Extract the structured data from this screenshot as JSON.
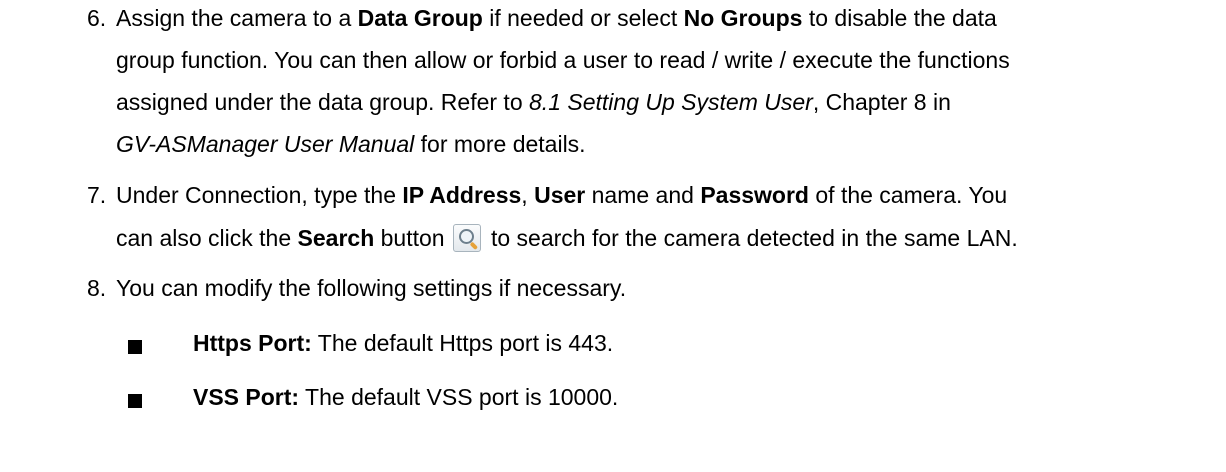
{
  "step6": {
    "number": "6.",
    "l1_a": "Assign the camera to a ",
    "l1_b": "Data Group",
    "l1_c": " if needed or select ",
    "l1_d": "No Groups",
    "l1_e": " to disable the data",
    "l2": "group function. You can then allow or forbid a user to read / write / execute the functions",
    "l3_a": "assigned under the data group. Refer to ",
    "l3_b": "8.1 Setting Up System User",
    "l3_c": ", Chapter 8 in",
    "l4_a": "GV-ASManager User Manual",
    "l4_b": " for more details."
  },
  "step7": {
    "number": "7.",
    "l1_a": "Under Connection, type the ",
    "l1_b": "IP Address",
    "l1_c": ", ",
    "l1_d": "User",
    "l1_e": " name and ",
    "l1_f": "Password",
    "l1_g": " of the camera. You",
    "l2_a": "can also click the ",
    "l2_b": "Search",
    "l2_c": " button",
    "l2_d": " to search for the camera detected in the same LAN.",
    "icon": "search-icon"
  },
  "step8": {
    "number": "8.",
    "l1": "You can modify the following settings if necessary."
  },
  "bullets": [
    {
      "label": "Https Port:",
      "text": " The default Https port is 443."
    },
    {
      "label": "VSS Port:",
      "text": " The default VSS port is 10000."
    }
  ]
}
